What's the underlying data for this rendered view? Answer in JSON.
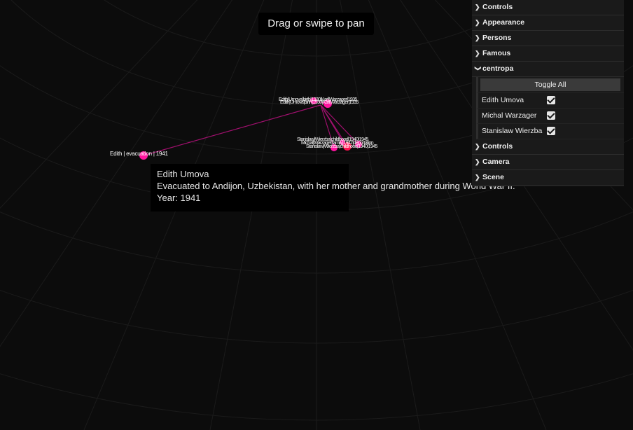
{
  "overlay": {
    "pan_hint": "Drag or swipe to pan"
  },
  "tooltip": {
    "name": "Edith Umova",
    "description": "Evacuated to Andijon, Uzbekistan, with her mother and grandmother during World War II.",
    "year_line": "Year: 1941"
  },
  "graph": {
    "link_color": "#b0127a",
    "node_color": "#ff1aa8",
    "node_labels": [
      {
        "text": "Edith | evacuation | 1941"
      },
      {
        "text": "Edith|Umova|birth|1930|Karl|Warzager|1935"
      },
      {
        "text": "Stanislaw|Wierzba|childhood|1940|1945"
      },
      {
        "text": "Michal|Warzager|family|1942|deportation"
      }
    ]
  },
  "gui": {
    "colors": {
      "panel_bg": "#1a1a1a",
      "button_bg": "#3a3a3a"
    },
    "folders_top": [
      {
        "label": "Controls",
        "icon": "chevron-down-icon"
      },
      {
        "label": "Appearance",
        "icon": "chevron-right-icon"
      },
      {
        "label": "Persons",
        "icon": "chevron-right-icon"
      },
      {
        "label": "Famous",
        "icon": "chevron-right-icon"
      },
      {
        "label": "centropa",
        "icon": "chevron-down-icon"
      }
    ],
    "toggle_all_label": "Toggle All",
    "persons": [
      {
        "name": "Edith Umova",
        "checked": true
      },
      {
        "name": "Michal Warzager",
        "checked": true
      },
      {
        "name": "Stanislaw Wierzba",
        "checked": true
      }
    ],
    "folders_bottom": [
      {
        "label": "Controls",
        "icon": "chevron-right-icon"
      },
      {
        "label": "Camera",
        "icon": "chevron-right-icon"
      },
      {
        "label": "Scene",
        "icon": "chevron-right-icon"
      }
    ]
  }
}
